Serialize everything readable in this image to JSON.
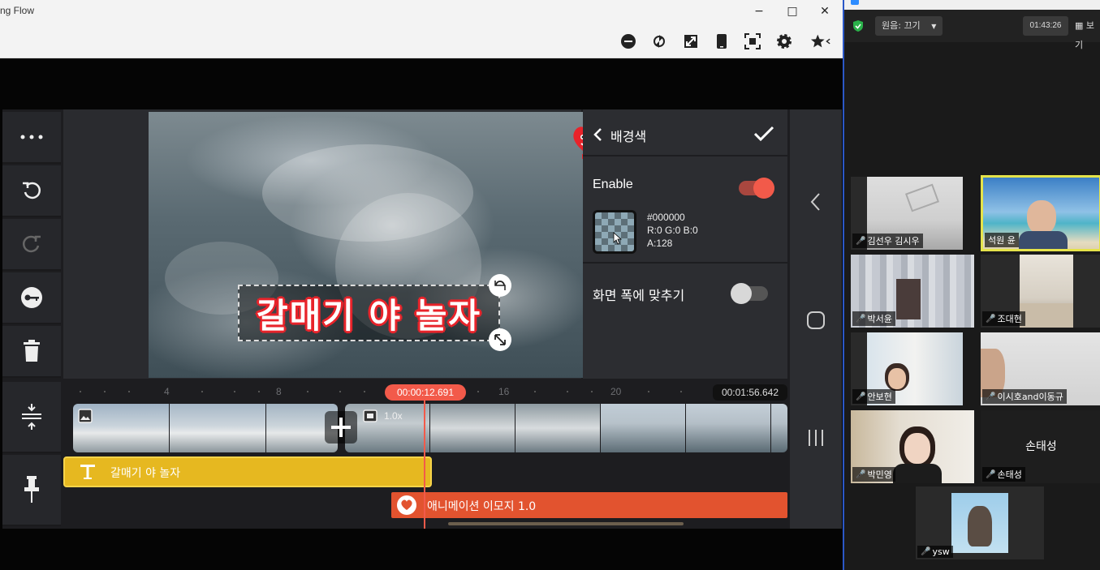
{
  "emulator": {
    "window_title": "ng Flow",
    "controls": {
      "minimize": "−",
      "maximize": "□",
      "close": "✕"
    }
  },
  "editor": {
    "panel": {
      "title": "배경색",
      "enable_label": "Enable",
      "enable_on": true,
      "color_hex": "#000000",
      "color_rgb": "R:0 G:0 B:0",
      "color_alpha": "A:128",
      "fit_label": "화면 폭에 맞추기",
      "fit_on": false
    },
    "caption_text": "갈매기 야 놀자",
    "timeline": {
      "ruler": [
        "4",
        "8",
        "16",
        "20"
      ],
      "current_time": "00:00:12.691",
      "total_time": "00:01:56.642",
      "clip_speed": "1.0x",
      "text_track_label": "갈매기 야 놀자",
      "sticker_track_label": "애니메이션 이모지 1.0"
    },
    "accent": "#f25a4a"
  },
  "zoom": {
    "audio_label": "원음: 끄기",
    "meeting_time": "01:43:26",
    "view_label": "보기",
    "participants": [
      {
        "name": "김선우 김시우"
      },
      {
        "name": "석원 윤"
      },
      {
        "name": "박서윤"
      },
      {
        "name": "조대현"
      },
      {
        "name": "안보현"
      },
      {
        "name": "이시호and이동규"
      },
      {
        "name": "박민영"
      },
      {
        "name": "손태성"
      },
      {
        "name": "ysw"
      }
    ]
  }
}
